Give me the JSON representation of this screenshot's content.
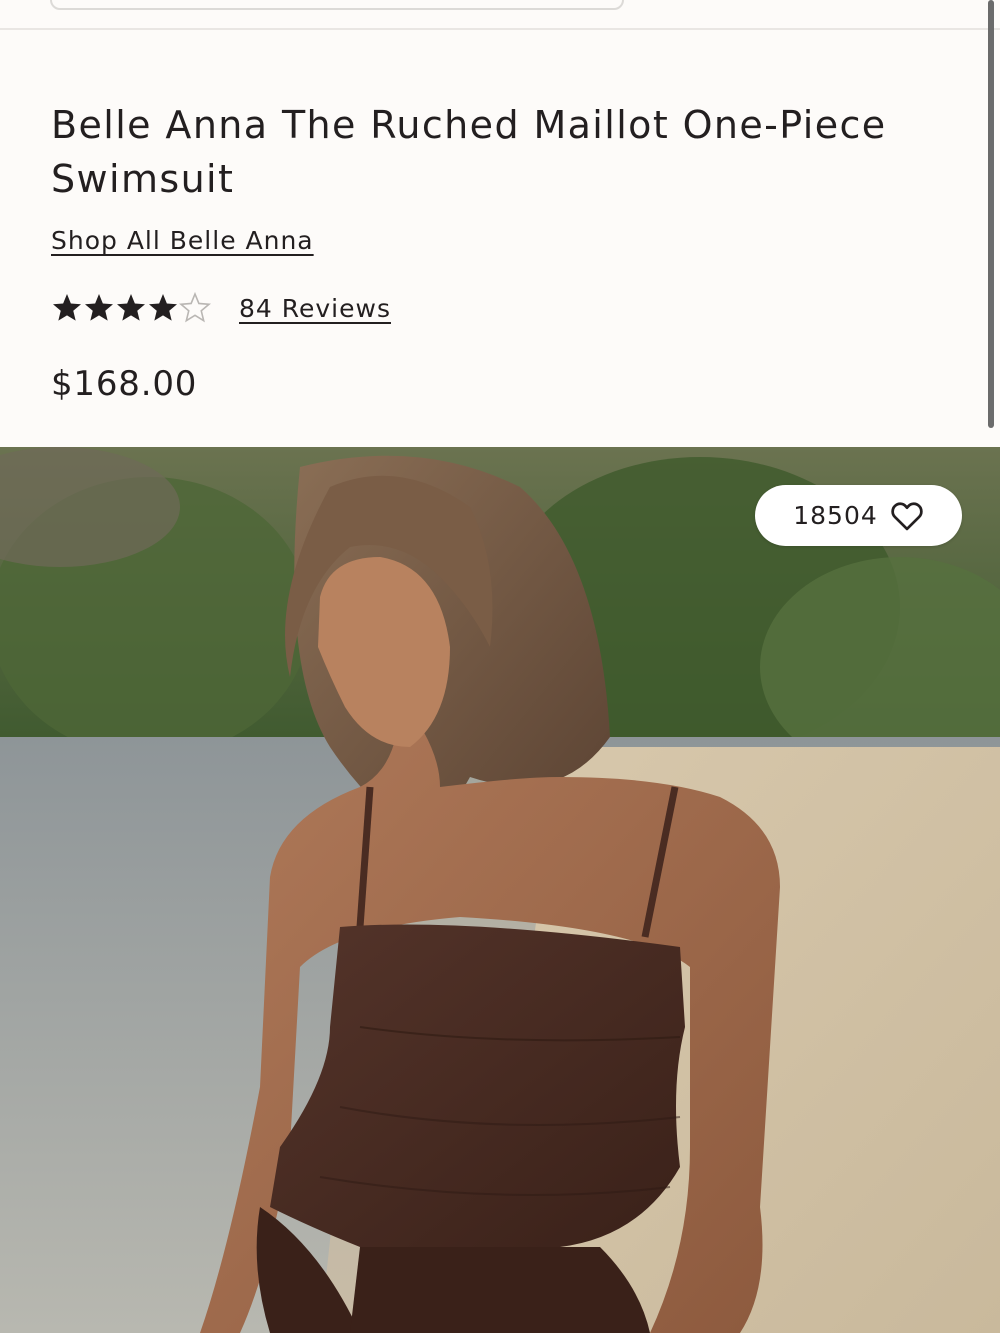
{
  "product": {
    "title": "Belle Anna The Ruched Maillot One-Piece Swimsuit",
    "brand_link": "Shop All Belle Anna",
    "rating_value": 4,
    "rating_max": 5,
    "reviews_link": "84 Reviews",
    "price": "$168.00"
  },
  "hero": {
    "wishlist_count": "18504",
    "icons": {
      "wishlist": "heart-outline-icon",
      "star_filled": "star-filled-icon",
      "star_empty": "star-outline-icon"
    }
  },
  "colors": {
    "text": "#231f20",
    "background": "#fdfbf9",
    "swimsuit": "#4a2c22",
    "star_empty": "#b9b6b3"
  }
}
